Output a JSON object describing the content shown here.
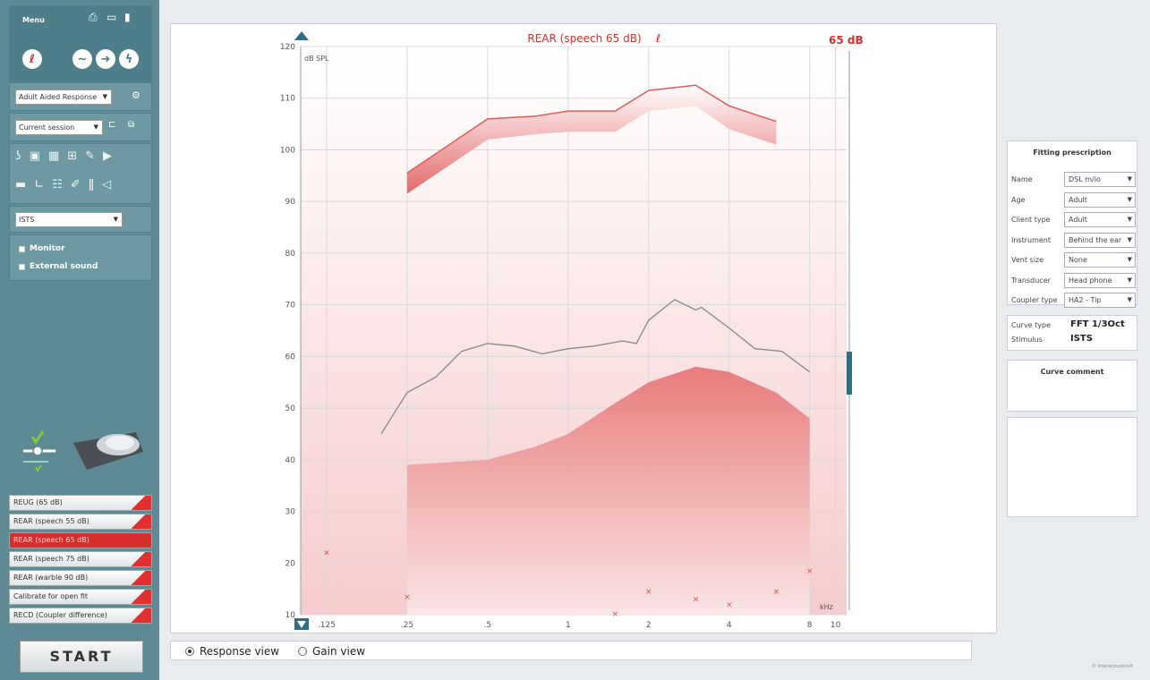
{
  "sidebar": {
    "menu_label": "Menu",
    "protocol_select": "Adult Aided Response",
    "session_select": "Current session",
    "stimulus_select": "ISTS",
    "monitor_label": "Monitor",
    "external_sound_label": "External sound",
    "measurements": [
      {
        "label": "REUG (65 dB)",
        "active": false
      },
      {
        "label": "REAR (speech 55 dB)",
        "active": false
      },
      {
        "label": "REAR (speech 65 dB)",
        "active": true
      },
      {
        "label": "REAR (speech 75 dB)",
        "active": false
      },
      {
        "label": "REAR (warble 90 dB)",
        "active": false
      },
      {
        "label": "Calibrate for open fit",
        "active": false
      },
      {
        "label": "RECD (Coupler difference)",
        "active": false
      }
    ],
    "start_label": "START"
  },
  "graph": {
    "title": "REAR (speech 65 dB)",
    "level_label": "65 dB",
    "y_unit": "dB SPL",
    "x_unit": "kHz"
  },
  "views": {
    "response_label": "Response view",
    "gain_label": "Gain view",
    "selected": "response"
  },
  "fitting": {
    "title": "Fitting prescription",
    "rows": [
      {
        "label": "Name",
        "value": "DSL m/io"
      },
      {
        "label": "Age",
        "value": "Adult"
      },
      {
        "label": "Client type",
        "value": "Adult"
      },
      {
        "label": "Instrument",
        "value": "Behind the ear"
      },
      {
        "label": "Vent size",
        "value": "None"
      },
      {
        "label": "Transducer",
        "value": "Head phone"
      },
      {
        "label": "Coupler type",
        "value": "HA2 - Tip"
      }
    ]
  },
  "curve_info": {
    "curve_type_label": "Curve type",
    "curve_type_value": "FFT 1/3Oct",
    "stimulus_label": "Stimulus",
    "stimulus_value": "ISTS",
    "comment_title": "Curve comment"
  },
  "footer": {
    "brand": "© Interacoustics®"
  },
  "colors": {
    "accent_red": "#d82d2d",
    "sidebar": "#5d8a94"
  },
  "chart_data": {
    "type": "line",
    "x_scale": "log",
    "xlim": [
      0.1,
      11
    ],
    "ylim": [
      10,
      120
    ],
    "y_ticks": [
      10,
      20,
      30,
      40,
      50,
      60,
      70,
      80,
      90,
      100,
      110,
      120
    ],
    "x_ticks": [
      {
        "value": 0.125,
        "label": ".125"
      },
      {
        "value": 0.25,
        "label": ".25"
      },
      {
        "value": 0.5,
        "label": ".5"
      },
      {
        "value": 1,
        "label": "1"
      },
      {
        "value": 2,
        "label": "2"
      },
      {
        "value": 4,
        "label": "4"
      },
      {
        "value": 8,
        "label": "8"
      },
      {
        "value": 10,
        "label": "10"
      }
    ],
    "upper_band": {
      "x": [
        0.25,
        0.5,
        0.75,
        1,
        1.5,
        2,
        3,
        4,
        6
      ],
      "y": [
        95.5,
        106,
        106.5,
        107.5,
        107.5,
        111.5,
        112.5,
        108.5,
        105.5
      ]
    },
    "lower_band": {
      "x": [
        0.25,
        0.5,
        0.75,
        1,
        1.5,
        2,
        3,
        4,
        6,
        8
      ],
      "y": [
        39,
        40,
        42.5,
        45,
        51,
        55,
        58,
        57,
        53,
        48
      ]
    },
    "response_curve": {
      "x": [
        0.2,
        0.25,
        0.32,
        0.4,
        0.5,
        0.63,
        0.8,
        1,
        1.25,
        1.6,
        1.8,
        2,
        2.5,
        3,
        3.15,
        4,
        5,
        6.3,
        8
      ],
      "y": [
        45,
        53,
        56,
        61,
        62.5,
        62,
        60.5,
        61.5,
        62,
        63,
        62.5,
        67,
        71,
        69,
        69.5,
        65.5,
        61.5,
        61,
        57
      ]
    },
    "markers": {
      "x": [
        0.125,
        0.25,
        1.5,
        2,
        3,
        4,
        6,
        8
      ],
      "y": [
        22,
        13.5,
        10.2,
        14.5,
        13,
        12,
        14.5,
        18.5
      ]
    }
  }
}
